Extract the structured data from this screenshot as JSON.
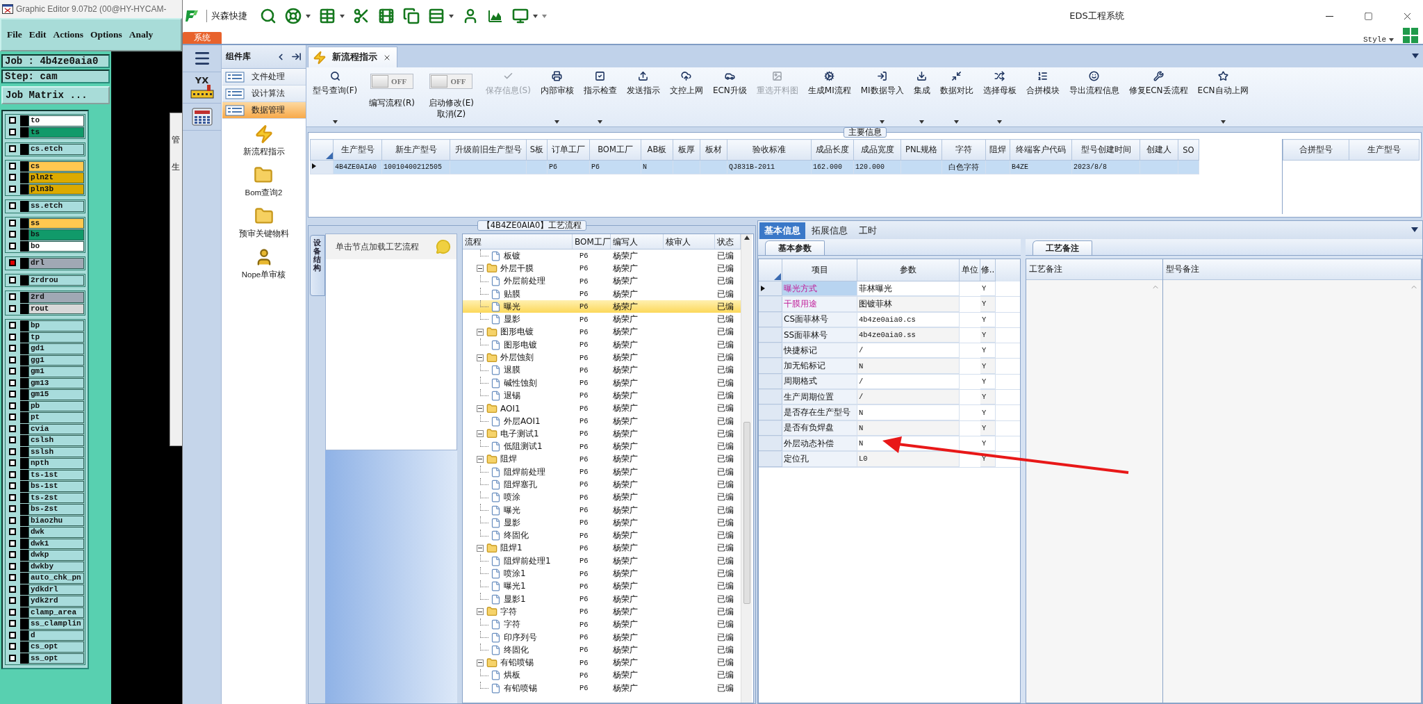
{
  "graphic_editor": {
    "title": "Graphic Editor 9.07b2 (00@HY-HYCAM-",
    "menu": [
      "File",
      "Edit",
      "Actions",
      "Options",
      "Analy"
    ],
    "job": "Job : 4b4ze0aia0",
    "step": "Step: cam",
    "matrix_button": "Job Matrix ...",
    "layer_groups": [
      [
        {
          "name": "to",
          "color": "#ffffff",
          "affected": false
        },
        {
          "name": "ts",
          "color": "#119a6a",
          "affected": false
        }
      ],
      [
        {
          "name": "cs.etch",
          "color": "#a8dcdc",
          "affected": false
        }
      ],
      [
        {
          "name": "cs",
          "color": "#ffc850",
          "affected": false
        },
        {
          "name": "pln2t",
          "color": "#dcaa00",
          "affected": false
        },
        {
          "name": "pln3b",
          "color": "#dcaa00",
          "affected": false
        }
      ],
      [
        {
          "name": "ss.etch",
          "color": "#a8dcdc",
          "affected": false
        }
      ],
      [
        {
          "name": "ss",
          "color": "#ffc850",
          "affected": false
        },
        {
          "name": "bs",
          "color": "#119a6a",
          "affected": false
        },
        {
          "name": "bo",
          "color": "#ffffff",
          "affected": false
        }
      ],
      [
        {
          "name": "drl",
          "color": "#a0a8b4",
          "affected": true
        }
      ],
      [
        {
          "name": "2rdrou",
          "color": "#a8dcdc",
          "affected": false
        }
      ],
      [
        {
          "name": "2rd",
          "color": "#a0a8b4",
          "affected": false
        },
        {
          "name": "rout",
          "color": "#d8d8d8",
          "affected": false
        }
      ],
      [
        {
          "name": "bp",
          "color": "#a8dcdc",
          "affected": false
        },
        {
          "name": "tp",
          "color": "#a8dcdc",
          "affected": false
        },
        {
          "name": "gd1",
          "color": "#a8dcdc",
          "affected": false
        },
        {
          "name": "gg1",
          "color": "#a8dcdc",
          "affected": false
        },
        {
          "name": "gm1",
          "color": "#a8dcdc",
          "affected": false
        },
        {
          "name": "gm13",
          "color": "#a8dcdc",
          "affected": false
        },
        {
          "name": "gm15",
          "color": "#a8dcdc",
          "affected": false
        },
        {
          "name": "pb",
          "color": "#a8dcdc",
          "affected": false
        },
        {
          "name": "pt",
          "color": "#a8dcdc",
          "affected": false
        },
        {
          "name": "cvia",
          "color": "#a8dcdc",
          "affected": false
        },
        {
          "name": "cslsh",
          "color": "#a8dcdc",
          "affected": false
        },
        {
          "name": "sslsh",
          "color": "#a8dcdc",
          "affected": false
        },
        {
          "name": "npth",
          "color": "#a8dcdc",
          "affected": false
        },
        {
          "name": "ts-1st",
          "color": "#a8dcdc",
          "affected": false
        },
        {
          "name": "bs-1st",
          "color": "#a8dcdc",
          "affected": false
        },
        {
          "name": "ts-2st",
          "color": "#a8dcdc",
          "affected": false
        },
        {
          "name": "bs-2st",
          "color": "#a8dcdc",
          "affected": false
        },
        {
          "name": "biaozhu",
          "color": "#a8dcdc",
          "affected": false
        },
        {
          "name": "dwk",
          "color": "#a8dcdc",
          "affected": false
        },
        {
          "name": "dwk1",
          "color": "#a8dcdc",
          "affected": false
        },
        {
          "name": "dwkp",
          "color": "#a8dcdc",
          "affected": false
        },
        {
          "name": "dwkby",
          "color": "#a8dcdc",
          "affected": false
        },
        {
          "name": "auto_chk_pn",
          "color": "#a8dcdc",
          "affected": false
        },
        {
          "name": "ydkdrl",
          "color": "#a8dcdc",
          "affected": false
        },
        {
          "name": "ydk2rd",
          "color": "#a8dcdc",
          "affected": false
        },
        {
          "name": "clamp_area",
          "color": "#a8dcdc",
          "affected": false
        },
        {
          "name": "ss_clamplin",
          "color": "#a8dcdc",
          "affected": false
        },
        {
          "name": "d",
          "color": "#a8dcdc",
          "affected": false
        },
        {
          "name": "cs_opt",
          "color": "#a8dcdc",
          "affected": false
        },
        {
          "name": "ss_opt",
          "color": "#a8dcdc",
          "affected": false
        }
      ]
    ],
    "dialog": {
      "title": "管",
      "label": "生"
    }
  },
  "eds": {
    "quick_access": "兴森快捷",
    "title": "EDS工程系统",
    "system_tab": "系统",
    "style_menu": "Style",
    "nav_logo": "YX",
    "component_library": {
      "title": "组件库",
      "categories": [
        {
          "label": "文件处理",
          "selected": false
        },
        {
          "label": "设计算法",
          "selected": false
        },
        {
          "label": "数据管理",
          "selected": true
        }
      ],
      "tools": [
        "新流程指示",
        "Bom查询2",
        "预审关键物料",
        "Nope单审核"
      ]
    },
    "doc_tabs": [
      {
        "label": "新流程指示",
        "selected": true
      }
    ],
    "ribbon": [
      {
        "kind": "button",
        "label": "型号查询(F)",
        "dropdown": true,
        "disabled": false
      },
      {
        "kind": "toggle",
        "label": "编写流程(R)",
        "on": false,
        "state_text": "OFF"
      },
      {
        "kind": "toggle",
        "label": "启动修改(E)",
        "label_2": "取消(Z)",
        "on": false,
        "state_text": "OFF"
      },
      {
        "kind": "button",
        "label": "保存信息(S)",
        "dropdown": false,
        "disabled": true
      },
      {
        "kind": "button",
        "label": "内部审核",
        "dropdown": true,
        "disabled": false
      },
      {
        "kind": "button",
        "label": "指示检查",
        "dropdown": true,
        "disabled": false
      },
      {
        "kind": "button",
        "label": "发送指示",
        "dropdown": false,
        "disabled": false
      },
      {
        "kind": "button",
        "label": "文控上网",
        "dropdown": false,
        "disabled": false
      },
      {
        "kind": "button",
        "label": "ECN升级",
        "dropdown": false,
        "disabled": false
      },
      {
        "kind": "button",
        "label": "重选开料图",
        "dropdown": false,
        "disabled": true
      },
      {
        "kind": "button",
        "label": "生成MI流程",
        "dropdown": false,
        "disabled": false
      },
      {
        "kind": "button",
        "label": "MI数据导入",
        "dropdown": true,
        "disabled": false
      },
      {
        "kind": "button",
        "label": "集成",
        "dropdown": true,
        "disabled": false
      },
      {
        "kind": "button",
        "label": "数据对比",
        "dropdown": true,
        "disabled": false
      },
      {
        "kind": "button",
        "label": "选择母板",
        "dropdown": true,
        "disabled": false
      },
      {
        "kind": "button",
        "label": "合拼模块",
        "dropdown": false,
        "disabled": false
      },
      {
        "kind": "button",
        "label": "导出流程信息",
        "dropdown": false,
        "disabled": false
      },
      {
        "kind": "button",
        "label": "修复ECN丢流程",
        "dropdown": false,
        "disabled": false
      },
      {
        "kind": "button",
        "label": "ECN自动上网",
        "dropdown": true,
        "disabled": false
      }
    ],
    "main_info": {
      "caption": "主要信息",
      "columns": [
        "生产型号",
        "新生产型号",
        "升级前旧生产型号",
        "S板",
        "订单工厂",
        "BOM工厂",
        "AB板",
        "板厚",
        "板材",
        "验收标准",
        "成品长度",
        "成品宽度",
        "PNL规格",
        "字符",
        "阻焊",
        "终端客户代码",
        "型号创建时间",
        "创建人",
        "SO"
      ],
      "rows": [
        {
          "selected": true,
          "cells": [
            "4B4ZE0AIA0",
            "10010400212505",
            null,
            null,
            "P6",
            "P6",
            "N",
            null,
            null,
            "QJ831B-2011",
            "162.000",
            "120.000",
            null,
            "白色字符",
            null,
            "B4ZE",
            "2023/8/8",
            null,
            null
          ]
        }
      ],
      "merge_columns": [
        "合拼型号",
        "生产型号"
      ]
    },
    "process": {
      "caption": "【4B4ZE0AIA0】工艺流程",
      "side_tab": "设备结构",
      "hint": "单击节点加载工艺流程",
      "columns": [
        "流程",
        "BOM工厂",
        "编写人",
        "核审人",
        "状态"
      ],
      "tree": [
        {
          "children": [
            {
              "label": "板镀",
              "bom": "P6",
              "writer": "杨荣广",
              "status": "已编",
              "selected": false
            }
          ]
        },
        {
          "label": "外层干膜",
          "bom": "P6",
          "writer": "杨荣广",
          "status": "已编",
          "selected": false,
          "expanded": true,
          "children": [
            {
              "label": "外层前处理",
              "bom": "P6",
              "writer": "杨荣广",
              "status": "已编",
              "selected": false
            },
            {
              "label": "贴膜",
              "bom": "P6",
              "writer": "杨荣广",
              "status": "已编",
              "selected": false
            },
            {
              "label": "曝光",
              "bom": "P6",
              "writer": "杨荣广",
              "status": "已编",
              "selected": true
            },
            {
              "label": "显影",
              "bom": "P6",
              "writer": "杨荣广",
              "status": "已编",
              "selected": false
            }
          ]
        },
        {
          "label": "图形电镀",
          "bom": "P6",
          "writer": "杨荣广",
          "status": "已编",
          "selected": false,
          "expanded": true,
          "children": [
            {
              "label": "图形电镀",
              "bom": "P6",
              "writer": "杨荣广",
              "status": "已编",
              "selected": false
            }
          ]
        },
        {
          "label": "外层蚀刻",
          "bom": "P6",
          "writer": "杨荣广",
          "status": "已编",
          "selected": false,
          "expanded": true,
          "children": [
            {
              "label": "退膜",
              "bom": "P6",
              "writer": "杨荣广",
              "status": "已编",
              "selected": false
            },
            {
              "label": "碱性蚀刻",
              "bom": "P6",
              "writer": "杨荣广",
              "status": "已编",
              "selected": false
            },
            {
              "label": "退锡",
              "bom": "P6",
              "writer": "杨荣广",
              "status": "已编",
              "selected": false
            }
          ]
        },
        {
          "label": "AOI1",
          "bom": "P6",
          "writer": "杨荣广",
          "status": "已编",
          "selected": false,
          "expanded": true,
          "children": [
            {
              "label": "外层AOI1",
              "bom": "P6",
              "writer": "杨荣广",
              "status": "已编",
              "selected": false
            }
          ]
        },
        {
          "label": "电子测试1",
          "bom": "P6",
          "writer": "杨荣广",
          "status": "已编",
          "selected": false,
          "expanded": true,
          "children": [
            {
              "label": "低阻测试1",
              "bom": "P6",
              "writer": "杨荣广",
              "status": "已编",
              "selected": false
            }
          ]
        },
        {
          "label": "阻焊",
          "bom": "P6",
          "writer": "杨荣广",
          "status": "已编",
          "selected": false,
          "expanded": true,
          "children": [
            {
              "label": "阻焊前处理",
              "bom": "P6",
              "writer": "杨荣广",
              "status": "已编",
              "selected": false
            },
            {
              "label": "阻焊塞孔",
              "bom": "P6",
              "writer": "杨荣广",
              "status": "已编",
              "selected": false
            },
            {
              "label": "喷涂",
              "bom": "P6",
              "writer": "杨荣广",
              "status": "已编",
              "selected": false
            },
            {
              "label": "曝光",
              "bom": "P6",
              "writer": "杨荣广",
              "status": "已编",
              "selected": false
            },
            {
              "label": "显影",
              "bom": "P6",
              "writer": "杨荣广",
              "status": "已编",
              "selected": false
            },
            {
              "label": "终固化",
              "bom": "P6",
              "writer": "杨荣广",
              "status": "已编",
              "selected": false
            }
          ]
        },
        {
          "label": "阻焊1",
          "bom": "P6",
          "writer": "杨荣广",
          "status": "已编",
          "selected": false,
          "expanded": true,
          "children": [
            {
              "label": "阻焊前处理1",
              "bom": "P6",
              "writer": "杨荣广",
              "status": "已编",
              "selected": false
            },
            {
              "label": "喷涂1",
              "bom": "P6",
              "writer": "杨荣广",
              "status": "已编",
              "selected": false
            },
            {
              "label": "曝光1",
              "bom": "P6",
              "writer": "杨荣广",
              "status": "已编",
              "selected": false
            },
            {
              "label": "显影1",
              "bom": "P6",
              "writer": "杨荣广",
              "status": "已编",
              "selected": false
            }
          ]
        },
        {
          "label": "字符",
          "bom": "P6",
          "writer": "杨荣广",
          "status": "已编",
          "selected": false,
          "expanded": true,
          "children": [
            {
              "label": "字符",
              "bom": "P6",
              "writer": "杨荣广",
              "status": "已编",
              "selected": false
            },
            {
              "label": "印序列号",
              "bom": "P6",
              "writer": "杨荣广",
              "status": "已编",
              "selected": false
            },
            {
              "label": "终固化",
              "bom": "P6",
              "writer": "杨荣广",
              "status": "已编",
              "selected": false
            }
          ]
        },
        {
          "label": "有铅喷锡",
          "bom": "P6",
          "writer": "杨荣广",
          "status": "已编",
          "selected": false,
          "expanded": true,
          "children": [
            {
              "label": "烘板",
              "bom": "P6",
              "writer": "杨荣广",
              "status": "已编",
              "selected": false
            },
            {
              "label": "有铅喷锡",
              "bom": "P6",
              "writer": "杨荣广",
              "status": "已编",
              "selected": false
            }
          ]
        }
      ]
    },
    "detail": {
      "tabs": [
        {
          "label": "基本信息",
          "selected": true
        },
        {
          "label": "拓展信息",
          "selected": false
        },
        {
          "label": "工时",
          "selected": false
        }
      ],
      "params": {
        "tab": "基本参数",
        "columns": [
          "项目",
          "参数",
          "单位",
          "修.."
        ],
        "rows": [
          {
            "item": "曝光方式",
            "value": "菲林曝光",
            "flag": "Y",
            "highlight": true,
            "selected": true
          },
          {
            "item": "干膜用途",
            "value": "图镀菲林",
            "flag": "Y",
            "highlight": true,
            "selected": false
          },
          {
            "item": "CS面菲林号",
            "value": "4b4ze0aia0.cs",
            "flag": "Y",
            "highlight": false,
            "selected": false
          },
          {
            "item": "SS面菲林号",
            "value": "4b4ze0aia0.ss",
            "flag": "Y",
            "highlight": false,
            "selected": false
          },
          {
            "item": "快捷标记",
            "value": "/",
            "flag": "Y",
            "highlight": false,
            "selected": false
          },
          {
            "item": "加无铅标记",
            "value": "N",
            "flag": "Y",
            "highlight": false,
            "selected": false
          },
          {
            "item": "周期格式",
            "value": "/",
            "flag": "Y",
            "highlight": false,
            "selected": false
          },
          {
            "item": "生产周期位置",
            "value": "/",
            "flag": "Y",
            "highlight": false,
            "selected": false
          },
          {
            "item": "是否存在生产型号",
            "value": "N",
            "flag": "Y",
            "highlight": false,
            "selected": false
          },
          {
            "item": "是否有负焊盘",
            "value": "N",
            "flag": "Y",
            "highlight": false,
            "selected": false
          },
          {
            "item": "外层动态补偿",
            "value": "N",
            "flag": "Y",
            "highlight": false,
            "selected": false
          },
          {
            "item": "定位孔",
            "value": "L0",
            "flag": "Y",
            "highlight": false,
            "selected": false
          }
        ]
      },
      "notes": {
        "tab": "工艺备注",
        "columns": [
          "工艺备注",
          "型号备注"
        ]
      }
    }
  }
}
